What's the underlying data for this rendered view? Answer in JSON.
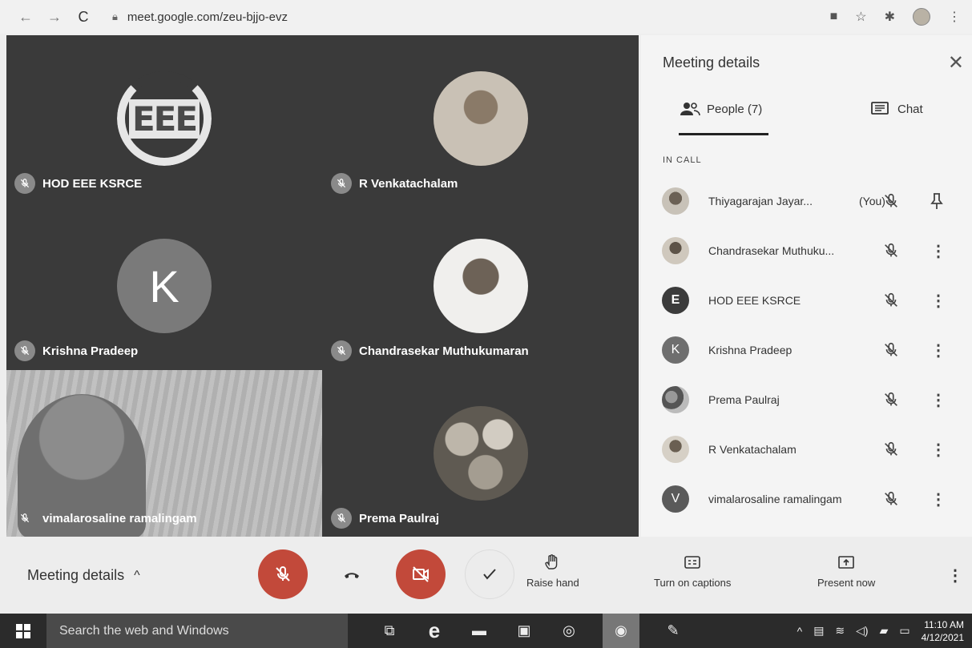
{
  "browser": {
    "url": "meet.google.com/zeu-bjjo-evz"
  },
  "tiles": [
    {
      "name": "HOD EEE KSRCE",
      "kind": "logo",
      "logo_text": "EEE"
    },
    {
      "name": "R Venkatachalam",
      "kind": "photo"
    },
    {
      "name": "Krishna Pradeep",
      "kind": "letter",
      "letter": "K"
    },
    {
      "name": "Chandrasekar Muthukumaran",
      "kind": "photo"
    },
    {
      "name": "vimalarosaline ramalingam",
      "kind": "video"
    },
    {
      "name": "Prema Paulraj",
      "kind": "photo"
    }
  ],
  "panel": {
    "title": "Meeting details",
    "tabs": {
      "people": "People (7)",
      "chat": "Chat"
    },
    "section": "IN CALL",
    "people": [
      {
        "name": "Thiyagarajan Jayar...",
        "you": "(You)",
        "avatar": "photo",
        "action": "pin"
      },
      {
        "name": "Chandrasekar Muthuku...",
        "avatar": "photo",
        "action": "more"
      },
      {
        "name": "HOD EEE KSRCE",
        "avatar": "logo",
        "letter": "E",
        "action": "more"
      },
      {
        "name": "Krishna Pradeep",
        "avatar": "letter",
        "letter": "K",
        "action": "more"
      },
      {
        "name": "Prema Paulraj",
        "avatar": "photo",
        "action": "more"
      },
      {
        "name": "R Venkatachalam",
        "avatar": "photo",
        "action": "more"
      },
      {
        "name": "vimalarosaline ramalingam",
        "avatar": "letter",
        "letter": "V",
        "action": "more"
      }
    ]
  },
  "bottom": {
    "meeting_details": "Meeting details",
    "raise_hand": "Raise hand",
    "captions": "Turn on captions",
    "present": "Present now"
  },
  "taskbar": {
    "search_placeholder": "Search the web and Windows",
    "time": "11:10 AM",
    "date": "4/12/2021"
  },
  "colors": {
    "red_control": "#c2493a",
    "grid_bg": "#3a3a3a",
    "panel_bg": "#f4f4f4"
  }
}
